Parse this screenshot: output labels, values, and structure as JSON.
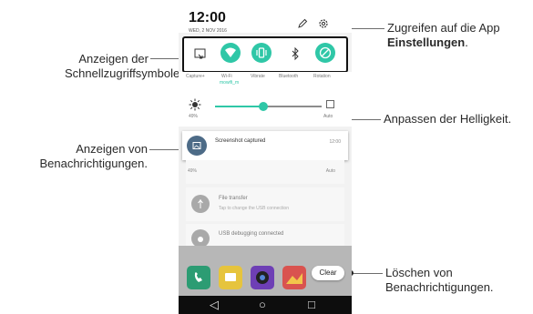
{
  "annotations": {
    "quick_settings": [
      "Anzeigen der",
      "Schnellzugriffsymbole."
    ],
    "notifications": [
      "Anzeigen von",
      "Benachrichtigungen."
    ],
    "settings_line1": "Zugreifen auf die App",
    "settings_bold": "Einstellungen",
    "settings_tail": ".",
    "brightness": "Anpassen der Helligkeit.",
    "clear": [
      "Löschen von",
      "Benachrichtigungen."
    ]
  },
  "phone": {
    "clock": "12:00",
    "date": "WED, 2 NOV 2016",
    "icons": {
      "edit": "pencil-icon",
      "settings": "gear-icon"
    },
    "quick_settings": [
      {
        "icon": "capture-plus-icon",
        "label": "Capture+",
        "sub": ""
      },
      {
        "icon": "wifi-icon",
        "label": "Wi-Fi",
        "sub": "mowifi_m"
      },
      {
        "icon": "vibrate-icon",
        "label": "Vibrate",
        "sub": ""
      },
      {
        "icon": "bluetooth-icon",
        "label": "Bluetooth",
        "sub": ""
      },
      {
        "icon": "rotation-icon",
        "label": "Rotation",
        "sub": ""
      }
    ],
    "brightness": {
      "percent": "49%",
      "auto_label": "Auto",
      "level": 0.45
    },
    "notification": {
      "title": "Screenshot captured",
      "time": "12:00"
    },
    "faded": {
      "brightness_percent": "49%",
      "brightness_auto": "Auto",
      "file_title": "File transfer",
      "file_sub": "Tap to change the USB connection",
      "usb_title": "USB debugging connected"
    },
    "clear_label": "Clear",
    "nav": {
      "back": "◁",
      "home": "○",
      "recents": "□"
    }
  },
  "colors": {
    "accent": "#2fc7a7",
    "leader": "#6d6d6d"
  }
}
